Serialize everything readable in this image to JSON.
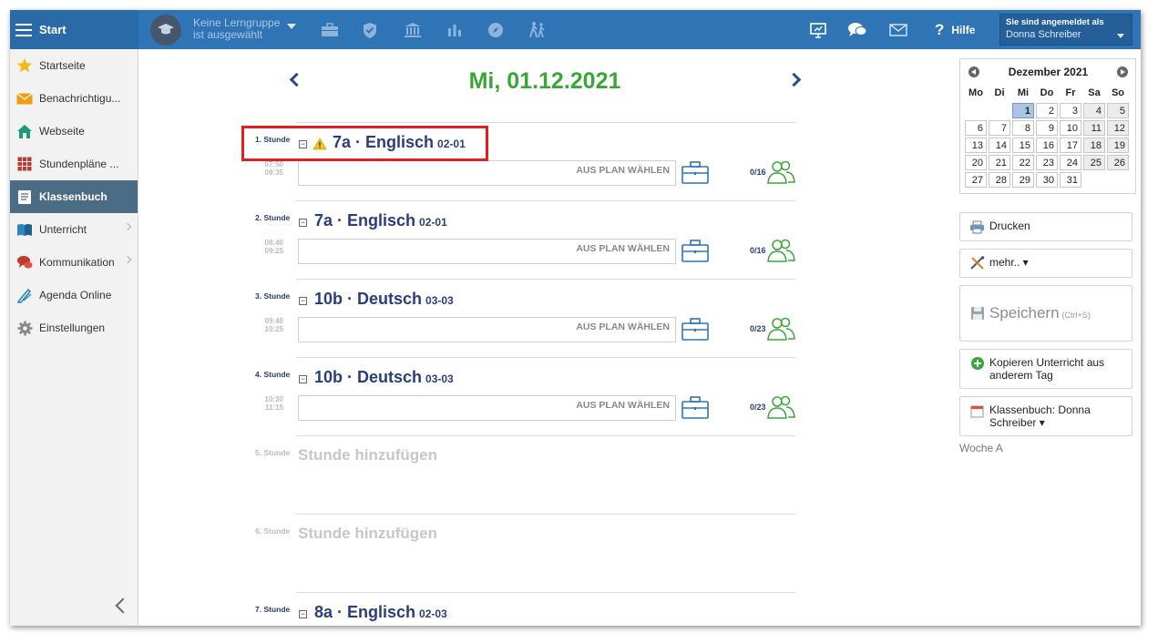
{
  "header": {
    "start_label": "Start",
    "group_line1": "Keine Lerngruppe",
    "group_line2": "ist ausgewählt",
    "help_label": "Hilfe",
    "user_line1": "Sie sind angemeldet als",
    "user_name": "Donna Schreiber",
    "icons": [
      "briefcase-icon",
      "shield-icon",
      "bank-icon",
      "bar-chart-icon",
      "compass-icon",
      "walking-icon",
      "presentation-icon",
      "chat-icon",
      "mail-icon"
    ]
  },
  "sidebar": {
    "items": [
      {
        "label": "Startseite",
        "icon": "star-icon"
      },
      {
        "label": "Benachrichtigu...",
        "icon": "envelope-icon"
      },
      {
        "label": "Webseite",
        "icon": "house-icon"
      },
      {
        "label": "Stundenpläne ...",
        "icon": "timetable-icon"
      },
      {
        "label": "Klassenbuch",
        "icon": "book-icon"
      },
      {
        "label": "Unterricht",
        "icon": "open-book-icon"
      },
      {
        "label": "Kommunikation",
        "icon": "speech-icon"
      },
      {
        "label": "Agenda Online",
        "icon": "pen-icon"
      },
      {
        "label": "Einstellungen",
        "icon": "gear-icon"
      }
    ]
  },
  "main": {
    "date": "Mi, 01.12.2021",
    "plan_placeholder": "AUS PLAN WÄHLEN",
    "lessons": [
      {
        "num": "1. Stunde",
        "class": "7a · Englisch",
        "room": "02-01",
        "start": "07:50",
        "end": "08:35",
        "count": "0/16"
      },
      {
        "num": "2. Stunde",
        "class": "7a · Englisch",
        "room": "02-01",
        "start": "08:40",
        "end": "09:25",
        "count": "0/16"
      },
      {
        "num": "3. Stunde",
        "class": "10b · Deutsch",
        "room": "03-03",
        "start": "09:40",
        "end": "10:25",
        "count": "0/23"
      },
      {
        "num": "4. Stunde",
        "class": "10b · Deutsch",
        "room": "03-03",
        "start": "10:30",
        "end": "11:15",
        "count": "0/23"
      },
      {
        "num": "5. Stunde",
        "placeholder": "Stunde hinzufügen"
      },
      {
        "num": "6. Stunde",
        "placeholder": "Stunde hinzufügen"
      },
      {
        "num": "7. Stunde",
        "class": "8a · Englisch",
        "room": "02-03"
      }
    ]
  },
  "calendar": {
    "month": "Dezember 2021",
    "weekdays": [
      "Mo",
      "Di",
      "Mi",
      "Do",
      "Fr",
      "Sa",
      "So"
    ],
    "selected": "1"
  },
  "right": {
    "print_label": "Drucken",
    "more_label": "mehr.. ▾",
    "save_label": "Speichern",
    "save_hint": "(Ctrl+S)",
    "copy_label": "Kopieren Unterricht aus anderem Tag",
    "classbook_label": "Klassenbuch: Donna Schreiber ▾",
    "week_label": "Woche A"
  },
  "colors": {
    "header": "#2f75b5",
    "date": "#3aa63a",
    "lesson_title": "#2b3d7a",
    "highlight": "#e02020",
    "icon_blue": "#2f75b5",
    "icon_green": "#3aa63a"
  }
}
